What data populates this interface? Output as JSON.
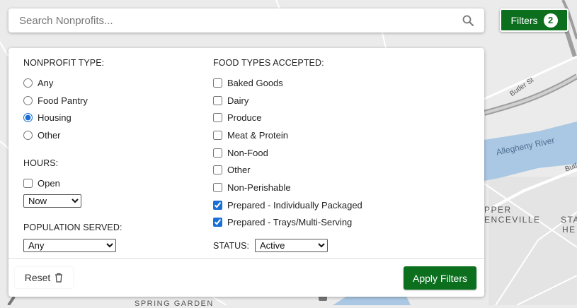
{
  "search": {
    "placeholder": "Search Nonprofits..."
  },
  "filters_button": {
    "label": "Filters",
    "count": "2"
  },
  "nonprofit_type": {
    "heading": "NONPROFIT TYPE:",
    "options": [
      {
        "label": "Any",
        "selected": false
      },
      {
        "label": "Food Pantry",
        "selected": false
      },
      {
        "label": "Housing",
        "selected": true
      },
      {
        "label": "Other",
        "selected": false
      }
    ]
  },
  "hours": {
    "heading": "HOURS:",
    "open_label": "Open",
    "open_checked": false,
    "select_value": "Now"
  },
  "population_served": {
    "heading": "POPULATION SERVED:",
    "select_value": "Any"
  },
  "food_types": {
    "heading": "FOOD TYPES ACCEPTED:",
    "options": [
      {
        "label": "Baked Goods",
        "checked": false
      },
      {
        "label": "Dairy",
        "checked": false
      },
      {
        "label": "Produce",
        "checked": false
      },
      {
        "label": "Meat & Protein",
        "checked": false
      },
      {
        "label": "Non-Food",
        "checked": false
      },
      {
        "label": "Other",
        "checked": false
      },
      {
        "label": "Non-Perishable",
        "checked": false
      },
      {
        "label": "Prepared - Individually Packaged",
        "checked": true
      },
      {
        "label": "Prepared - Trays/Multi-Serving",
        "checked": true
      }
    ]
  },
  "status": {
    "label": "STATUS:",
    "select_value": "Active"
  },
  "reset_label": "Reset",
  "apply_label": "Apply Filters",
  "map_labels": {
    "river": "Allegheny River",
    "butler_st": "Butler St",
    "butler_short": "Butl",
    "upper": "PPER",
    "lawrenceville": "ENCEVILLE",
    "stan": "STA",
    "hei": "HE",
    "garden": "SPRING GARDEN"
  },
  "colors": {
    "accent_green": "#0b6f1e",
    "river_blue": "#aac8e3",
    "map_bg": "#ebebeb"
  }
}
